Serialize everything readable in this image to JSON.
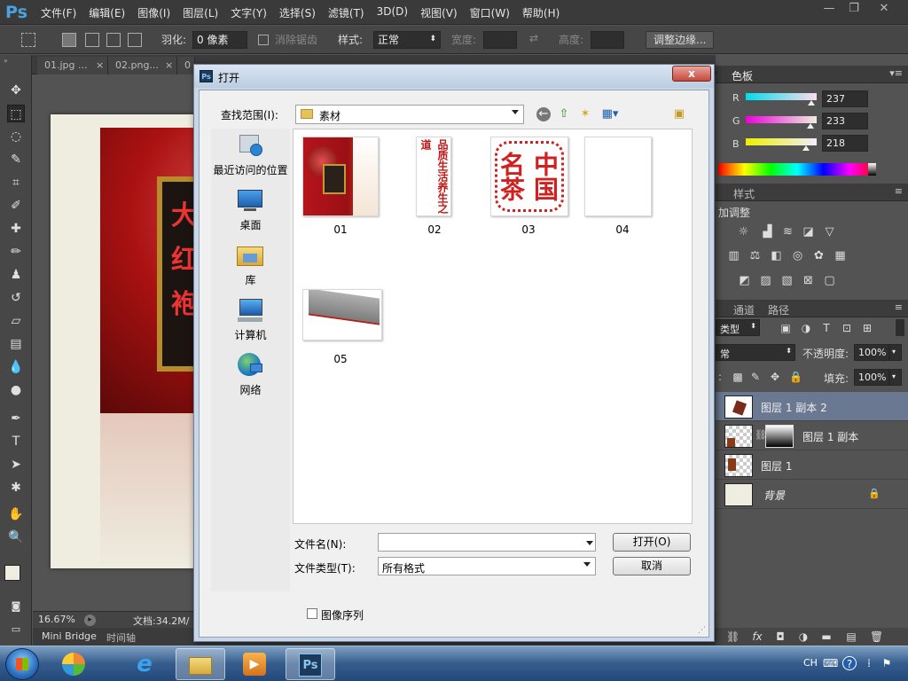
{
  "app": {
    "logo": "Ps",
    "menu": [
      "文件(F)",
      "编辑(E)",
      "图像(I)",
      "图层(L)",
      "文字(Y)",
      "选择(S)",
      "滤镜(T)",
      "3D(D)",
      "视图(V)",
      "窗口(W)",
      "帮助(H)"
    ],
    "window_controls": {
      "minimize": "—",
      "restore": "❐",
      "close": "✕"
    }
  },
  "options_bar": {
    "feather_label": "羽化:",
    "feather_value": "0 像素",
    "antialias_label": "消除锯齿",
    "style_label": "样式:",
    "style_value": "正常",
    "width_label": "宽度:",
    "height_label": "高度:",
    "refine_edge_button": "调整边缘..."
  },
  "doc_tabs": [
    "01.jpg ...",
    "02.png...",
    "0"
  ],
  "status_bar": {
    "zoom": "16.67%",
    "doc_info": "文档:34.2M/"
  },
  "bottom_tabs": [
    "Mini Bridge",
    "时间轴"
  ],
  "color_panel": {
    "tab": "色板",
    "channels": [
      {
        "label": "R",
        "value": "237",
        "level": 0.93
      },
      {
        "label": "G",
        "value": "233",
        "level": 0.91
      },
      {
        "label": "B",
        "value": "218",
        "level": 0.85
      }
    ]
  },
  "adjustments_panel": {
    "tabs": [
      "样式"
    ],
    "title": "加调整"
  },
  "layers_panel": {
    "tabs": [
      "通道",
      "路径"
    ],
    "filter_value": "类型",
    "blend_mode": "常",
    "opacity_label": "不透明度:",
    "opacity_value": "100%",
    "fill_label": "填充:",
    "fill_value": "100%",
    "layers": [
      {
        "name": "图层 1 副本 2",
        "selected": true
      },
      {
        "name": "图层 1 副本",
        "selected": false
      },
      {
        "name": "图层 1",
        "selected": false
      },
      {
        "name": "背景",
        "selected": false
      }
    ]
  },
  "dialog": {
    "title": "打开",
    "close_label": "x",
    "icon_text": "Ps",
    "lookin_label": "查找范围(I):",
    "lookin_value": "素材",
    "places": [
      "最近访问的位置",
      "桌面",
      "库",
      "计算机",
      "网络"
    ],
    "files": [
      "01",
      "02",
      "03",
      "04",
      "05"
    ],
    "thumb02_text": "品质生活养生之道",
    "thumb03_text": "中国名茶",
    "filename_label": "文件名(N):",
    "filename_value": "",
    "filetype_label": "文件类型(T):",
    "filetype_value": "所有格式",
    "open_button": "打开(O)",
    "cancel_button": "取消",
    "image_sequence_label": "图像序列"
  },
  "taskbar": {
    "tray_lang": "CH",
    "ps_label": "Ps"
  },
  "colors": {
    "ps_blue": "#4aa3e0",
    "dialog_frame": "#c8d6e6",
    "selected_layer": "#6a7892"
  }
}
